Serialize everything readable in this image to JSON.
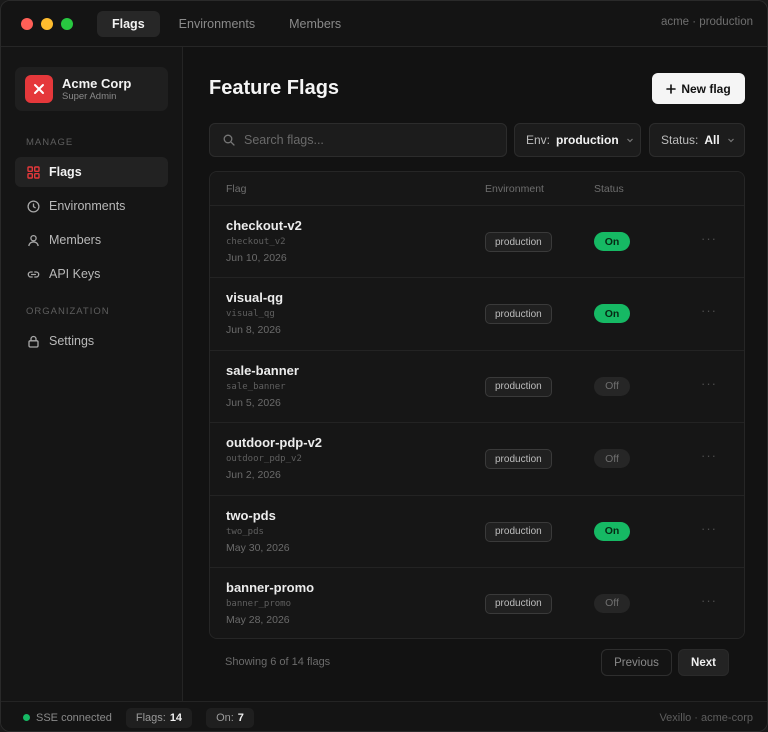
{
  "titlebar": {
    "traffic_lights": [
      "#ff5f57",
      "#febc2e",
      "#28c840"
    ],
    "tabs": [
      {
        "label": "Flags",
        "active": true
      },
      {
        "label": "Environments",
        "active": false
      },
      {
        "label": "Members",
        "active": false
      }
    ],
    "context": "acme · production"
  },
  "sidebar": {
    "org": {
      "name": "Acme Corp",
      "role": "Super Admin",
      "logo_color": "#e5383b",
      "logo_icon": "x-icon"
    },
    "manage_label": "MANAGE",
    "org_label": "ORGANIZATION",
    "items": [
      {
        "label": "Flags",
        "icon": "grid-icon",
        "active": true
      },
      {
        "label": "Environments",
        "icon": "clock-icon",
        "active": false
      },
      {
        "label": "Members",
        "icon": "user-icon",
        "active": false
      },
      {
        "label": "API Keys",
        "icon": "link-icon",
        "active": false
      },
      {
        "label": "Settings",
        "icon": "lock-icon",
        "active": false
      }
    ]
  },
  "main": {
    "title": "Feature Flags",
    "new_flag_label": "New flag",
    "search_placeholder": "Search flags...",
    "env_filter": {
      "label": "Env:",
      "value": "production"
    },
    "status_filter": {
      "label": "Status:",
      "value": "All"
    },
    "columns": [
      "Flag",
      "Environment",
      "Status"
    ],
    "rows": [
      {
        "name": "checkout-v2",
        "key": "checkout_v2",
        "date": "Jun 10, 2026",
        "env": "production",
        "status": "On"
      },
      {
        "name": "visual-qg",
        "key": "visual_qg",
        "date": "Jun 8, 2026",
        "env": "production",
        "status": "On"
      },
      {
        "name": "sale-banner",
        "key": "sale_banner",
        "date": "Jun 5, 2026",
        "env": "production",
        "status": "Off"
      },
      {
        "name": "outdoor-pdp-v2",
        "key": "outdoor_pdp_v2",
        "date": "Jun 2, 2026",
        "env": "production",
        "status": "Off"
      },
      {
        "name": "two-pds",
        "key": "two_pds",
        "date": "May 30, 2026",
        "env": "production",
        "status": "On"
      },
      {
        "name": "banner-promo",
        "key": "banner_promo",
        "date": "May 28, 2026",
        "env": "production",
        "status": "Off"
      }
    ],
    "pager": {
      "info": "Showing 6 of 14 flags",
      "prev_label": "Previous",
      "next_label": "Next"
    }
  },
  "statusbar": {
    "sse": "SSE connected",
    "flags_label": "Flags:",
    "flags_count": "14",
    "on_label": "On:",
    "on_count": "7",
    "brand": "Vexillo · acme-corp"
  },
  "colors": {
    "accent_green": "#16b964",
    "accent_red": "#e5383b"
  }
}
